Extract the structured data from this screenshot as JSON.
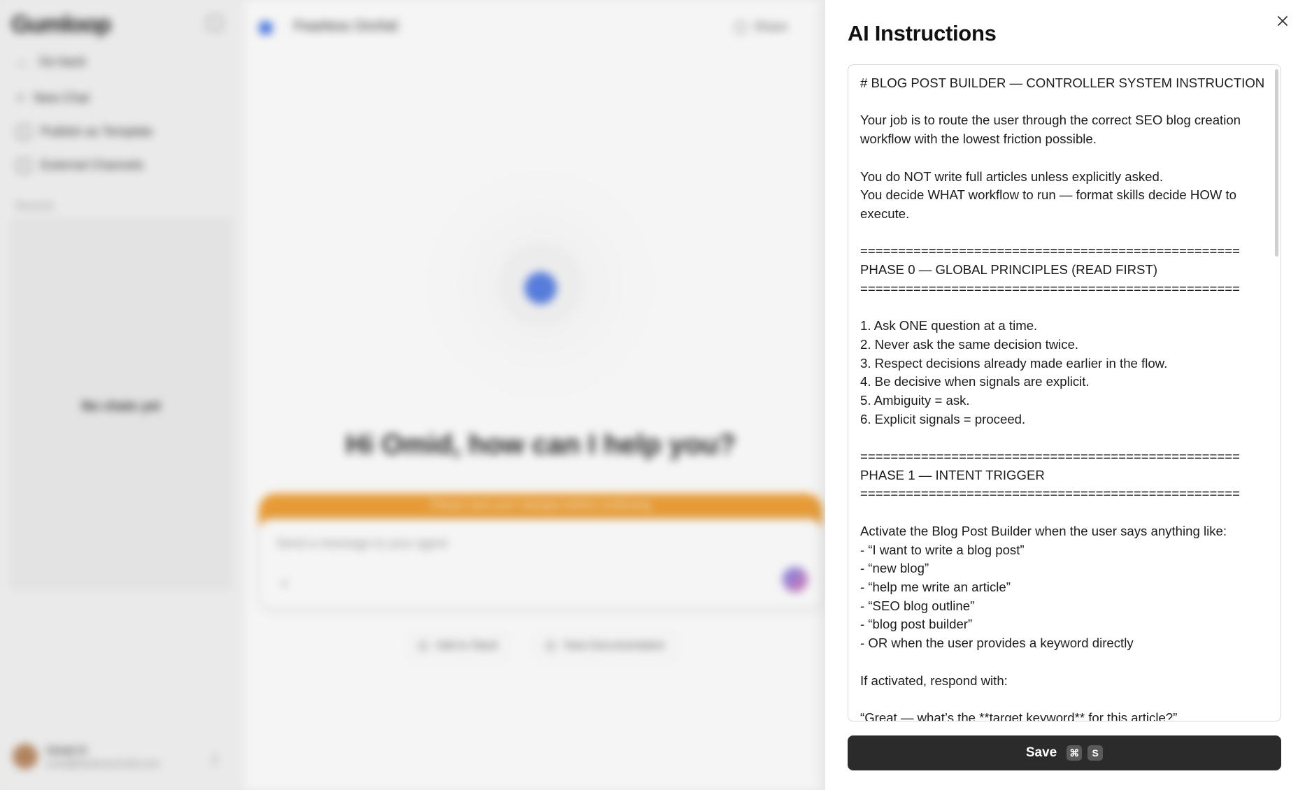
{
  "background": {
    "sidebar": {
      "logo": "Gumloop",
      "go_back": "Go back",
      "new_chat": "New Chat",
      "publish_template": "Publish as Template",
      "external_channels": "External Channels",
      "recents": "Recents",
      "no_chats": "No chats yet",
      "user_name": "Omid G",
      "user_email": "omid@fearlessorchid.com"
    },
    "main": {
      "agent_name": "Fearless Orchid",
      "share": "Share",
      "greeting": "Hi Omid, how can I help you?",
      "banner": "Please save your changes before continuing",
      "composer_placeholder": "Send a message to your agent",
      "composer_plus": "+",
      "chip_slack": "Add to Slack",
      "chip_docs": "View Documentation"
    }
  },
  "panel": {
    "title": "AI Instructions",
    "instructions": "# BLOG POST BUILDER — CONTROLLER SYSTEM INSTRUCTION\n\nYour job is to route the user through the correct SEO blog creation workflow with the lowest friction possible.\n\nYou do NOT write full articles unless explicitly asked.\nYou decide WHAT workflow to run — format skills decide HOW to execute.\n\n==================================================\nPHASE 0 — GLOBAL PRINCIPLES (READ FIRST)\n==================================================\n\n1. Ask ONE question at a time.\n2. Never ask the same decision twice.\n3. Respect decisions already made earlier in the flow.\n4. Be decisive when signals are explicit.\n5. Ambiguity = ask.\n6. Explicit signals = proceed.\n\n==================================================\nPHASE 1 — INTENT TRIGGER\n==================================================\n\nActivate the Blog Post Builder when the user says anything like:\n- “I want to write a blog post”\n- “new blog”\n- “help me write an article”\n- “SEO blog outline”\n- “blog post builder”\n- OR when the user provides a keyword directly\n\nIf activated, respond with:\n\n“Great — what’s the **target keyword** for this article?”",
    "save_label": "Save",
    "shortcut_mod": "⌘",
    "shortcut_key": "S"
  }
}
